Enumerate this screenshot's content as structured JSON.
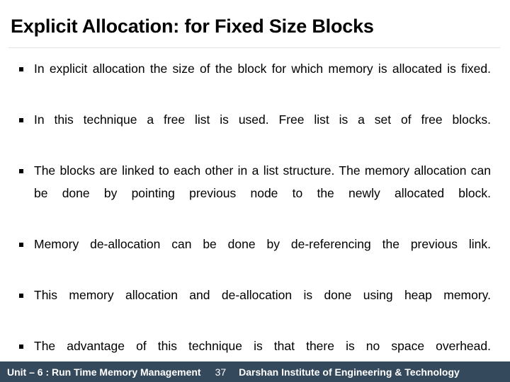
{
  "slide": {
    "title": "Explicit Allocation: for Fixed Size Blocks",
    "bullets": [
      {
        "marker": "black-square-bullet",
        "text": "In explicit allocation the size of the block for which memory is allocated is fixed."
      },
      {
        "marker": "black-square-bullet",
        "text": "In this technique a free list is used. Free list is a set of free blocks."
      },
      {
        "marker": "black-square-bullet",
        "text": "The blocks are linked to each other in a list structure. The memory allocation can be done by pointing previous node to the newly allocated block."
      },
      {
        "marker": "black-square-bullet",
        "text": "Memory de-allocation can be done by de-referencing the previous link."
      },
      {
        "marker": "black-square-bullet",
        "text": "This memory allocation and de-allocation is done using heap memory."
      },
      {
        "marker": "black-square-bullet",
        "text": "The advantage of this technique is that there is no space overhead."
      }
    ],
    "footer": {
      "unit_label": "Unit – 6 : Run Time Memory Management",
      "page_number": "37",
      "organization": "Darshan Institute of Engineering & Technology",
      "background_color": "#35495c",
      "text_color": "#ffffff"
    },
    "colors": {
      "background": "#ffffff",
      "title_text": "#000000",
      "body_text": "#000000",
      "divider": "#e3e3e3"
    }
  }
}
